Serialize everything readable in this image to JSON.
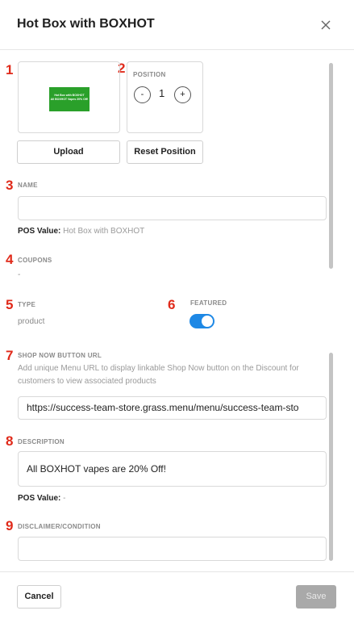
{
  "dialog": {
    "title": "Hot Box with BOXHOT",
    "close_icon": "close-icon"
  },
  "markers": [
    "1",
    "2",
    "3",
    "4",
    "5",
    "6",
    "7",
    "8",
    "9"
  ],
  "image": {
    "thumb_line1": "Hot Box with BOXHOT",
    "thumb_line2": "All BOXHOT Vapes 20% Off!",
    "thumb_color": "#2aa02a",
    "upload_label": "Upload"
  },
  "position": {
    "label": "POSITION",
    "decrement": "-",
    "value": "1",
    "increment": "+",
    "reset_label": "Reset Position"
  },
  "name": {
    "label": "NAME",
    "value": "",
    "pos_key": "POS Value:",
    "pos_value": "Hot Box with BOXHOT"
  },
  "coupons": {
    "label": "COUPONS",
    "value": "-"
  },
  "type": {
    "label": "TYPE",
    "value": "product"
  },
  "featured": {
    "label": "FEATURED",
    "enabled": true,
    "color": "#1e88e5"
  },
  "shop_now": {
    "label": "SHOP NOW BUTTON URL",
    "help": "Add unique Menu URL to display linkable Shop Now button on the Discount for customers to view associated products",
    "value": "https://success-team-store.grass.menu/menu/success-team-sto"
  },
  "description": {
    "label": "DESCRIPTION",
    "value": "All BOXHOT vapes are 20% Off!",
    "pos_key": "POS Value:",
    "pos_value": "-"
  },
  "disclaimer": {
    "label": "DISCLAIMER/CONDITION",
    "value": ""
  },
  "footer": {
    "cancel_label": "Cancel",
    "save_label": "Save"
  }
}
